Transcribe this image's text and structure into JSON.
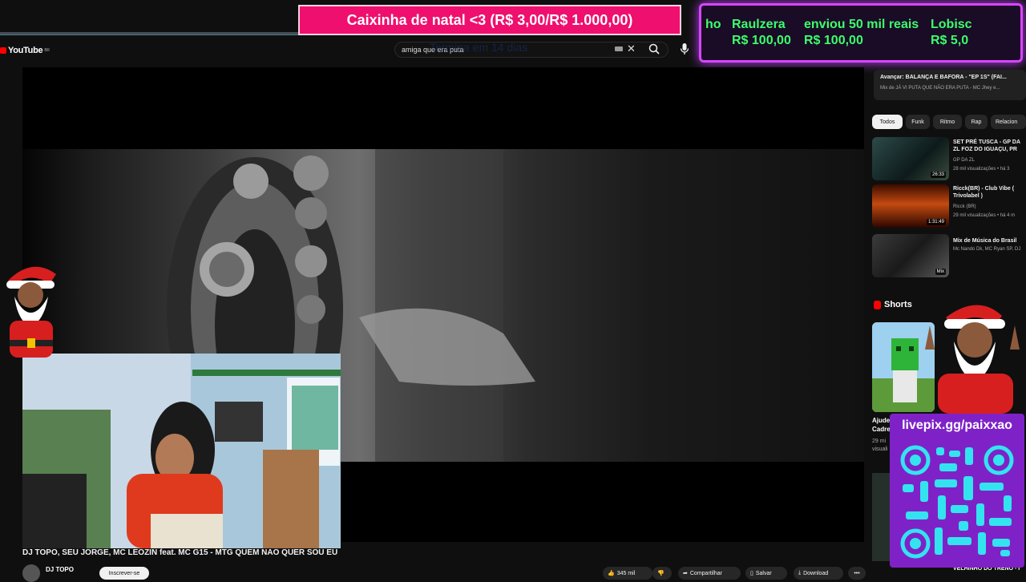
{
  "youtube": {
    "logo_text": "YouTube",
    "logo_region": "BR",
    "search": {
      "value": "amiga que era puta",
      "ghost_text": "Termina em 14 dias"
    }
  },
  "overlay": {
    "donation_banner": "Caixinha de natal <3 (R$ 3,00/R$ 1.000,00)",
    "ticker": [
      {
        "line1": "ho",
        "line2": ""
      },
      {
        "line1": "Raulzera",
        "line2": "R$ 100,00"
      },
      {
        "line1": "enviou 50 mil reais",
        "line2": "R$ 100,00"
      },
      {
        "line1": "Lobisc",
        "line2": "R$ 5,0"
      }
    ],
    "livepix_url": "livepix.gg/paixxao"
  },
  "video": {
    "title": "DJ TOPO, SEU JORGE, MC LEOZIN feat. MC G15 - MTG QUEM NAO QUER SOU EU",
    "channel": "DJ TOPO",
    "subscribe_label": "Inscrever-se",
    "likes": "345 mil",
    "share_label": "Compartilhar",
    "save_label": "Salvar",
    "download_label": "Download",
    "more_label": "•••"
  },
  "sidebar": {
    "up_next": {
      "title": "Avançar: BALANÇA E BAFORA - \"EP 1S\" (FAI...",
      "subtitle": "Mix de JÁ VI PUTA QUE NÃO ERA PUTA - MC Jhey e..."
    },
    "chips": [
      "Todos",
      "Funk",
      "Ritmo",
      "Rap",
      "Relacion"
    ],
    "recommendations": [
      {
        "title": "SET PRÉ TUSCA - GP DA ZL FOZ DO IGUAÇU, PR",
        "channel": "GP DA ZL",
        "meta": "28 mil visualizações • há 3",
        "duration": "26:33"
      },
      {
        "title": "Ricck(BR) - Club Vibe ( Trivolabel )",
        "channel": "Ricck (BR)",
        "meta": "29 mil visualizações • há 4 m",
        "duration": "1:31:49"
      },
      {
        "title": "Mix de Música do Brasil",
        "channel": "Mc Nando Dk, MC Ryan SP, DJ",
        "meta": "",
        "duration": "Mix"
      }
    ],
    "shorts_label": "Shorts",
    "short_caption": "Ajude Cadre",
    "short_meta": "29 mi visuali",
    "bottom_item": "VELHINHO DO TRENÓ - I"
  },
  "colors": {
    "banner": "#ef0f6e",
    "ticker_text": "#3cff6c",
    "ticker_border": "#d845ff",
    "livepix_bg": "#7e22c8",
    "qr": "#34e3f0"
  }
}
